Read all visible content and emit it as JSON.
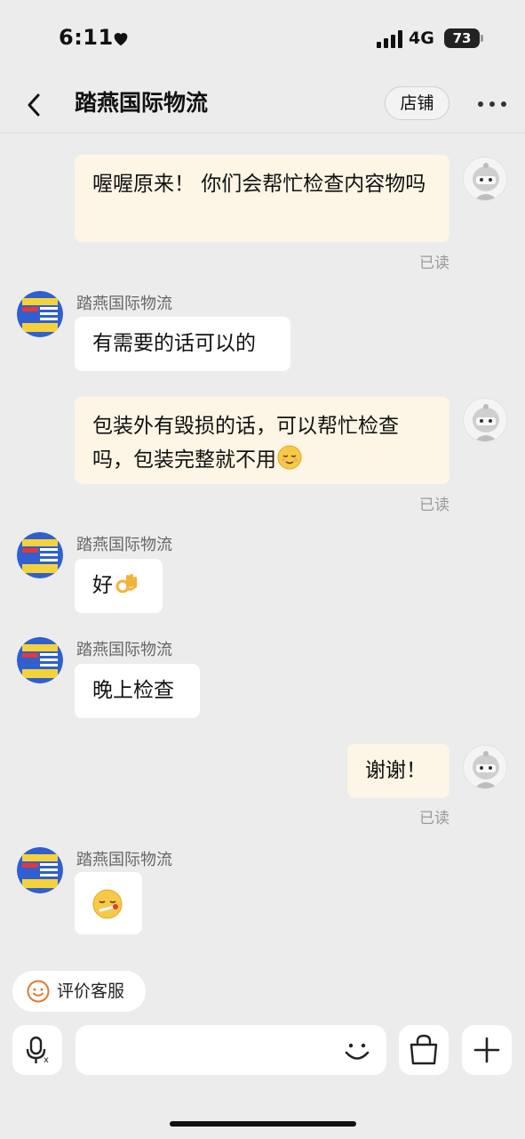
{
  "status_bar": {
    "time": "6:11",
    "network": "4G",
    "battery": "73"
  },
  "header": {
    "title": "踏燕国际物流",
    "shop_button": "店铺"
  },
  "messages": [
    {
      "from": "me",
      "text": "喔喔原来！ 你们会帮忙检查内容物吗",
      "read": "已读"
    },
    {
      "from": "shop",
      "sender": "踏燕国际物流",
      "text": "有需要的话可以的"
    },
    {
      "from": "me",
      "text": "包装外有毁损的话，可以帮忙检查吗，包装完整就不用",
      "emoji": "relieved-face",
      "read": "已读"
    },
    {
      "from": "shop",
      "sender": "踏燕国际物流",
      "text": "好",
      "emoji": "ok-hand"
    },
    {
      "from": "shop",
      "sender": "踏燕国际物流",
      "text": "晚上检查"
    },
    {
      "from": "me",
      "text": "谢谢！",
      "read": "已读"
    },
    {
      "from": "shop",
      "sender": "踏燕国际物流",
      "emoji": "face-with-thermometer"
    }
  ],
  "rate_chip": {
    "label": "评价客服"
  },
  "input_bar": {
    "placeholder": ""
  },
  "colors": {
    "my_bubble": "#fdf5e5",
    "their_bubble": "#ffffff",
    "background": "#ececec",
    "chip_icon": "#e07a2e"
  }
}
